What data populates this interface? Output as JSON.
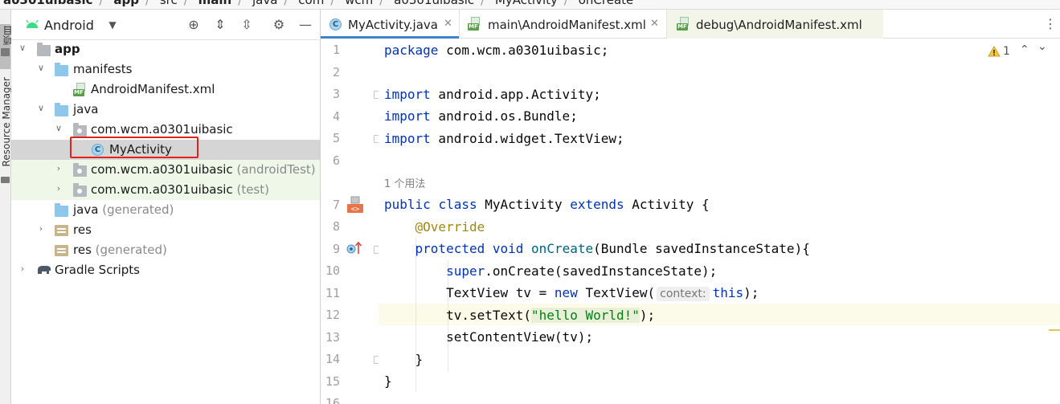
{
  "breadcrumb": [
    "a0301uibasic",
    "app",
    "src",
    "main",
    "java",
    "com",
    "wcm",
    "a0301uibasic",
    "MyActivity",
    "onCreate"
  ],
  "tool_strip": {
    "project_label": "项目",
    "resource_manager_label": "Resource Manager"
  },
  "project_panel": {
    "view_mode": "Android",
    "tree": [
      {
        "label": "app",
        "suffix": "",
        "expanded": true
      },
      {
        "label": "manifests",
        "suffix": "",
        "expanded": true
      },
      {
        "label": "AndroidManifest.xml",
        "suffix": ""
      },
      {
        "label": "java",
        "suffix": "",
        "expanded": true
      },
      {
        "label": "com.wcm.a0301uibasic",
        "suffix": "",
        "expanded": true
      },
      {
        "label": "MyActivity",
        "suffix": "",
        "selected": true
      },
      {
        "label": "com.wcm.a0301uibasic",
        "suffix": "(androidTest)"
      },
      {
        "label": "com.wcm.a0301uibasic",
        "suffix": "(test)"
      },
      {
        "label": "java",
        "suffix": "(generated)"
      },
      {
        "label": "res",
        "suffix": ""
      },
      {
        "label": "res",
        "suffix": "(generated)"
      },
      {
        "label": "Gradle Scripts",
        "suffix": ""
      }
    ]
  },
  "editor": {
    "tabs": [
      {
        "label": "MyActivity.java",
        "active": true
      },
      {
        "label": "main\\AndroidManifest.xml",
        "active": false
      },
      {
        "label": "debug\\AndroidManifest.xml",
        "active": false
      }
    ],
    "warning_count": "1",
    "line_numbers": [
      "1",
      "2",
      "3",
      "4",
      "5",
      "6",
      "7",
      "8",
      "9",
      "10",
      "11",
      "12",
      "13",
      "14",
      "15",
      "16"
    ],
    "usage_hint": "1 个用法",
    "code": {
      "pkg_kw": "package",
      "pkg_name": " com.wcm.a0301uibasic;",
      "import_kw": "import",
      "import1": " android.app.Activity;",
      "import2": " android.os.Bundle;",
      "import3": " android.widget.TextView;",
      "public_kw": "public",
      "class_kw": "class",
      "class_name": " MyActivity ",
      "extends_kw": "extends",
      "extends_rest": " Activity {",
      "override": "@Override",
      "protected_kw": "protected",
      "void_kw": "void",
      "oncreate": "onCreate",
      "oncreate_params": "(Bundle savedInstanceState){",
      "super_kw": "super",
      "super_rest": ".onCreate(savedInstanceState);",
      "tv_decl": "TextView tv = ",
      "new_kw": "new",
      "tv_ctor": " TextView(",
      "param_hint": "context:",
      "this_kw": "this",
      "tv_end": ");",
      "settext": "tv.setText(",
      "hello": "\"hello World!\"",
      "settext_end": ");",
      "setcontent": "setContentView(tv);",
      "close_method": "}",
      "close_class": "}"
    }
  },
  "colors": {
    "keyword": "#0033b3",
    "annotation": "#9e880d",
    "string": "#067d17",
    "method": "#00627a",
    "selection_border": "#e0231f",
    "active_tab_underline": "#4083c9"
  }
}
